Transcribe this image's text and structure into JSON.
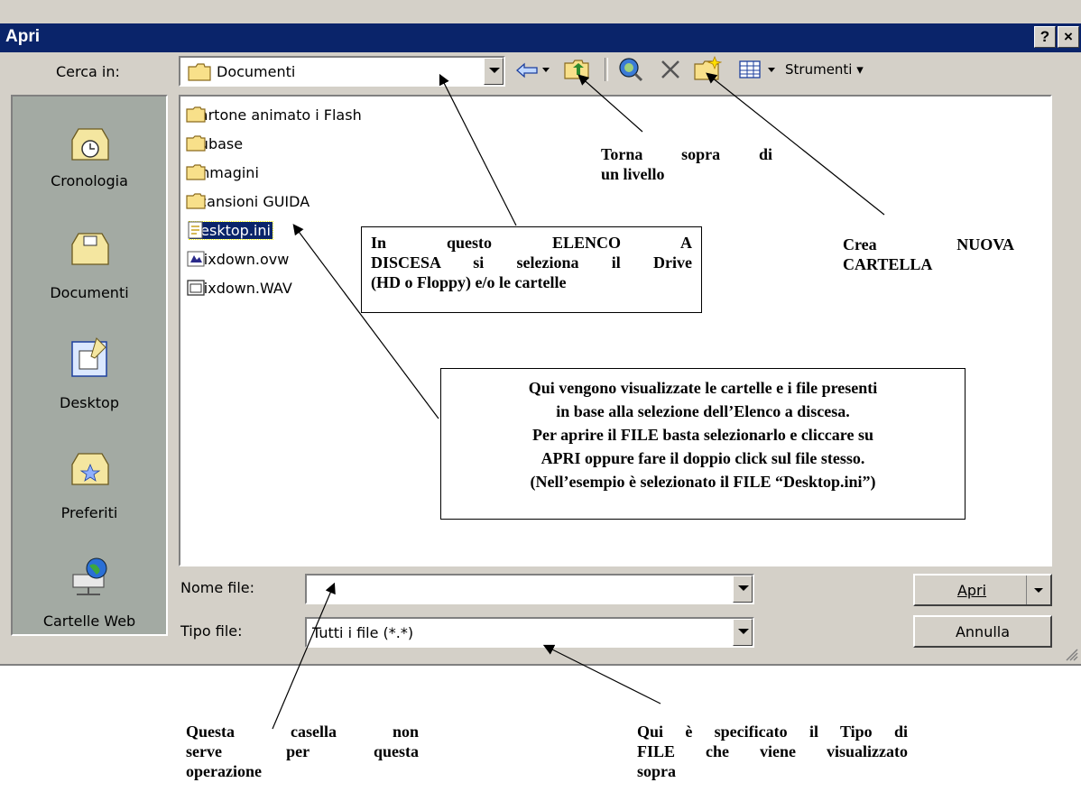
{
  "dialog": {
    "title": "Apri",
    "help_button": "?",
    "close_button": "×"
  },
  "lookin": {
    "label": "Cerca in:",
    "value": "Documenti"
  },
  "toolbar": {
    "tools_label": "Strumenti"
  },
  "places": [
    {
      "label": "Cronologia",
      "icon": "history-icon"
    },
    {
      "label": "Documenti",
      "icon": "documents-icon"
    },
    {
      "label": "Desktop",
      "icon": "desktop-icon"
    },
    {
      "label": "Preferiti",
      "icon": "favorites-icon"
    },
    {
      "label": "Cartelle Web",
      "icon": "web-folders-icon"
    }
  ],
  "files": [
    {
      "name": "cartone animato i Flash",
      "icon": "folder-icon"
    },
    {
      "name": "cubase",
      "icon": "folder-icon"
    },
    {
      "name": "Immagini",
      "icon": "folder-icon"
    },
    {
      "name": "scansioni GUIDA",
      "icon": "folder-icon"
    },
    {
      "name": "desktop.ini",
      "icon": "ini-file-icon",
      "selected": true
    },
    {
      "name": "Mixdown.ovw",
      "icon": "ovw-file-icon"
    },
    {
      "name": "Mixdown.WAV",
      "icon": "wav-file-icon"
    }
  ],
  "filename": {
    "label": "Nome file:",
    "value": ""
  },
  "filetype": {
    "label": "Tipo file:",
    "value": "Tutti i file (*.*)"
  },
  "buttons": {
    "open": "Apri",
    "cancel": "Annulla"
  },
  "annotations": {
    "up_level": [
      "Torna sopra di",
      "un livello"
    ],
    "dropdown": [
      "In questo ELENCO A",
      "DISCESA si seleziona il Drive",
      "(HD o Floppy) e/o le cartelle"
    ],
    "new_folder": [
      "Crea NUOVA",
      "CARTELLA"
    ],
    "file_area": [
      "Qui vengono visualizzate le cartelle e i file presenti",
      "in base alla selezione dell’Elenco a discesa.",
      "Per aprire il FILE basta selezionarlo e cliccare su",
      "APRI oppure fare il doppio click sul file stesso.",
      "(Nell’esempio è selezionato il FILE “Desktop.ini”)"
    ],
    "filename_box": [
      "Questa casella non",
      "serve per questa",
      "operazione"
    ],
    "filetype_box": [
      "Qui è specificato il Tipo di",
      "FILE che viene visualizzato",
      "sopra"
    ]
  },
  "colors": {
    "titlebar": "#0a246a",
    "dialog": "#d4d0c8",
    "places_bar": "#a3aaa3",
    "selection": "#0a246a"
  }
}
